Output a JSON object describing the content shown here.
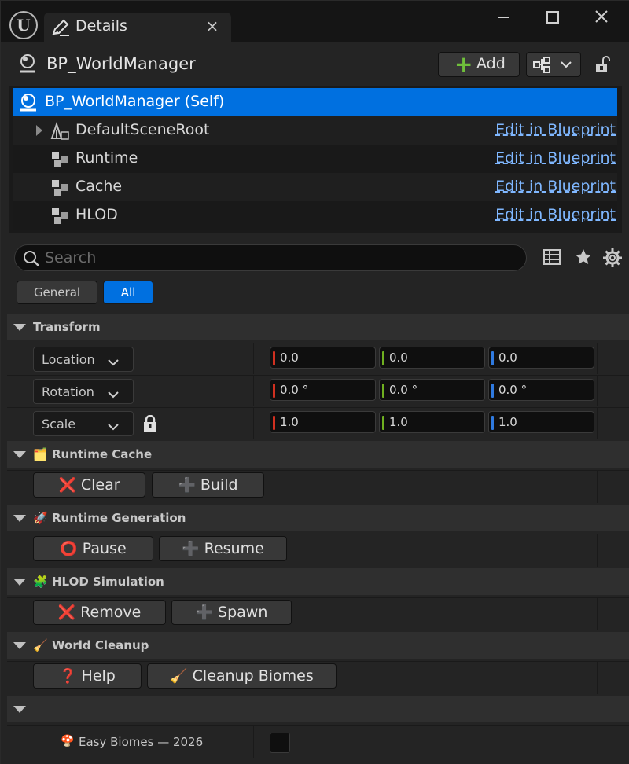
{
  "window": {
    "tab_title": "Details",
    "tab_close": "×",
    "minimize": "–",
    "maximize": "☐",
    "close": "✕"
  },
  "header": {
    "actor_name": "BP_WorldManager",
    "add_label": "Add"
  },
  "components": [
    {
      "label": "BP_WorldManager (Self)",
      "selected": true
    },
    {
      "label": "DefaultSceneRoot",
      "link": "Edit in Blueprint"
    },
    {
      "label": "Runtime",
      "link": "Edit in Blueprint"
    },
    {
      "label": "Cache",
      "link": "Edit in Blueprint"
    },
    {
      "label": "HLOD",
      "link": "Edit in Blueprint"
    }
  ],
  "search": {
    "placeholder": "Search"
  },
  "filters": {
    "general": "General",
    "all": "All"
  },
  "transform": {
    "title": "Transform",
    "location": {
      "label": "Location",
      "x": "0.0",
      "y": "0.0",
      "z": "0.0"
    },
    "rotation": {
      "label": "Rotation",
      "x": "0.0 °",
      "y": "0.0 °",
      "z": "0.0 °"
    },
    "scale": {
      "label": "Scale",
      "x": "1.0",
      "y": "1.0",
      "z": "1.0"
    }
  },
  "sections": {
    "runtime_cache": {
      "title": "Runtime Cache",
      "emoji": "🗂️",
      "btn1": "Clear",
      "btn1_icon": "❌",
      "btn2": "Build",
      "btn2_icon": "➕"
    },
    "runtime_generation": {
      "title": "Runtime Generation",
      "emoji": "🚀",
      "btn1": "Pause",
      "btn1_icon": "⭕",
      "btn2": "Resume",
      "btn2_icon": "➕"
    },
    "hlod_simulation": {
      "title": "HLOD Simulation",
      "emoji": "🧩",
      "btn1": "Remove",
      "btn1_icon": "❌",
      "btn2": "Spawn",
      "btn2_icon": "➕"
    },
    "world_cleanup": {
      "title": "World Cleanup",
      "emoji": "🧹",
      "btn1": "Help",
      "btn1_icon": "❓",
      "btn2": "Cleanup Biomes",
      "btn2_icon": "🧹"
    }
  },
  "footer": {
    "emoji": "🍄",
    "label": "Easy Biomes — 2026",
    "checked": false
  },
  "colors": {
    "accent": "#0070e0",
    "x_axis": "#d03020",
    "y_axis": "#6fb020",
    "z_axis": "#2f7ae0",
    "link": "#7fb7ff"
  }
}
